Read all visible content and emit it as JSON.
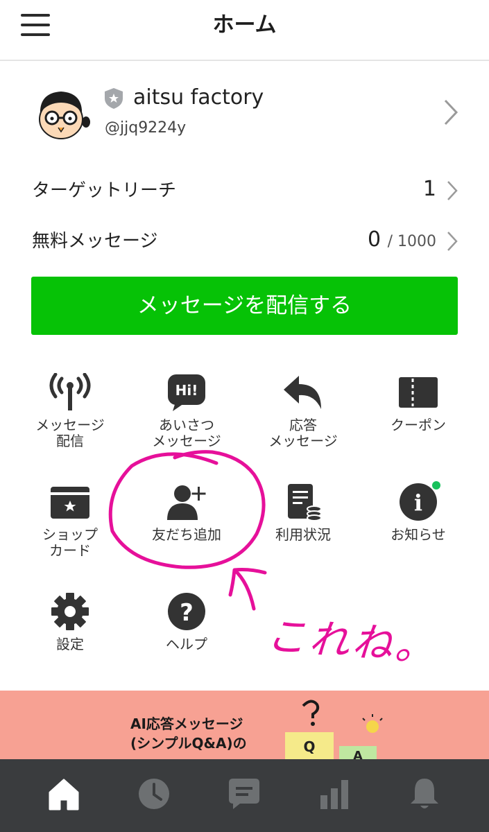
{
  "header": {
    "title": "ホーム"
  },
  "account": {
    "name": "aitsu factory",
    "id": "@jjq9224y"
  },
  "stats": [
    {
      "label": "ターゲットリーチ",
      "value": "1",
      "suffix": ""
    },
    {
      "label": "無料メッセージ",
      "value": "0",
      "suffix": "/ 1000"
    }
  ],
  "cta": {
    "label": "メッセージを配信する"
  },
  "grid": [
    {
      "label": "メッセージ\n配信"
    },
    {
      "label": "あいさつ\nメッセージ"
    },
    {
      "label": "応答\nメッセージ"
    },
    {
      "label": "クーポン"
    },
    {
      "label": "ショップ\nカード"
    },
    {
      "label": "友だち追加"
    },
    {
      "label": "利用状況"
    },
    {
      "label": "お知らせ"
    },
    {
      "label": "設定"
    },
    {
      "label": "ヘルプ"
    }
  ],
  "icons": {
    "hi_bubble": "Hi!",
    "info": "i",
    "help": "?"
  },
  "annotation": {
    "text": "これね。"
  },
  "banner": {
    "text": "AI応答メッセージ\n(シンプルQ&A)の",
    "q_label": "Q",
    "a_label": "A"
  },
  "colors": {
    "accent": "#06c206",
    "annotation": "#e6109a",
    "nav_bg": "#3a3c3e",
    "banner_bg": "#f7a193",
    "notice_dot": "#19c15c"
  }
}
